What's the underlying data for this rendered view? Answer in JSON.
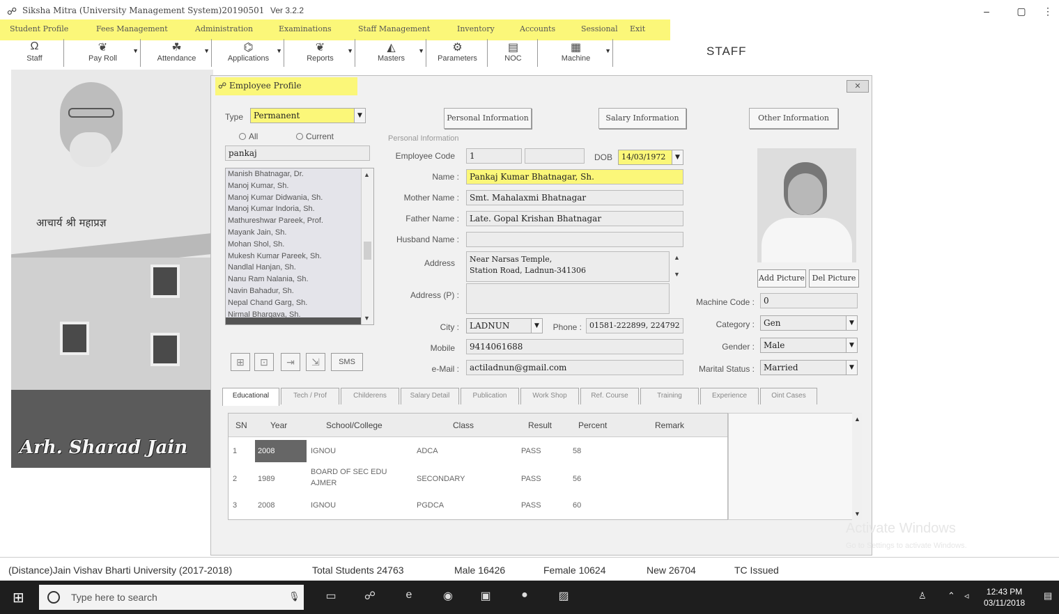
{
  "window": {
    "title": "Siksha Mitra (University Management System)20190501",
    "version": "Ver 3.2.2",
    "minimize": "–",
    "restore": "▢",
    "close": "⋮"
  },
  "menu": [
    "Student Profile",
    "Fees Management",
    "Administration",
    "Examinations",
    "Staff Management",
    "Inventory",
    "Accounts",
    "Sessional",
    "Exit"
  ],
  "toolbar": [
    {
      "label": "Staff",
      "icon": "Ω"
    },
    {
      "label": "Pay Roll",
      "icon": "❦"
    },
    {
      "label": "Attendance",
      "icon": "☘"
    },
    {
      "label": "Applications",
      "icon": "⌬"
    },
    {
      "label": "Reports",
      "icon": "❦"
    },
    {
      "label": "Masters",
      "icon": "◭"
    },
    {
      "label": "Parameters",
      "icon": "⚙"
    },
    {
      "label": "NOC",
      "icon": "▤"
    },
    {
      "label": "Machine",
      "icon": "▦"
    }
  ],
  "module_title": "STAFF",
  "background": {
    "hindi_text": "आचार्य श्री महाप्रज्ञ",
    "signature": "Arh. Sharad Jain"
  },
  "profile": {
    "title": "Employee Profile",
    "close_label": "✕",
    "type_label": "Type",
    "type_value": "Permanent",
    "radio_all": "All",
    "radio_current": "Current",
    "search_value": "pankaj",
    "employees": [
      "Manish Bhatnagar, Dr.",
      "Manoj Kumar, Sh.",
      "Manoj Kumar Didwania, Sh.",
      "Manoj Kumar Indoria, Sh.",
      "Mathureshwar Pareek, Prof.",
      "Mayank Jain, Sh.",
      "Mohan Shol, Sh.",
      "Mukesh Kumar Pareek, Sh.",
      "Nandlal Hanjan, Sh.",
      "Nanu Ram Nalania, Sh.",
      "Navin Bahadur, Sh.",
      "Nepal Chand Garg, Sh.",
      "Nirmal Bhargava, Sh."
    ],
    "sms_label": "SMS",
    "nav_icons": [
      "⊞",
      "⊡",
      "⇥",
      "⇲"
    ],
    "buttons": {
      "personal": "Personal Information",
      "salary": "Salary Information",
      "other": "Other Information"
    },
    "section": "Personal Information",
    "labels": {
      "employee_code": "Employee Code",
      "dob": "DOB",
      "name": "Name :",
      "mother": "Mother Name :",
      "father": "Father Name :",
      "husband": "Husband Name :",
      "address": "Address",
      "address_p": "Address (P) :",
      "city": "City :",
      "phone": "Phone :",
      "mobile": "Mobile",
      "email": "e-Mail :",
      "machine_code": "Machine Code :",
      "category": "Category :",
      "gender": "Gender :",
      "marital": "Marital Status :"
    },
    "values": {
      "employee_code": "1",
      "dob": "14/03/1972",
      "name": "Pankaj Kumar Bhatnagar, Sh.",
      "mother": "Smt. Mahalaxmi Bhatnagar",
      "father": "Late. Gopal Krishan Bhatnagar",
      "husband": "",
      "address_line1": "Near Narsas Temple,",
      "address_line2": "Station Road, Ladnun-341306",
      "address_p": "",
      "city": "LADNUN",
      "phone": "01581-222899, 224792",
      "mobile": "9414061688",
      "email": "actiladnun@gmail.com",
      "machine_code": "0",
      "category": "Gen",
      "gender": "Male",
      "marital": "Married"
    },
    "add_picture": "Add Picture",
    "del_picture": "Del Picture",
    "tabs": [
      "Educational",
      "Tech / Prof",
      "Childerens",
      "Salary Detail",
      "Publication",
      "Work Shop",
      "Ref. Course",
      "Training",
      "Experience",
      "Oint Cases"
    ],
    "grid": {
      "headers": [
        "SN",
        "Year",
        "School/College",
        "Class",
        "Result",
        "Percent",
        "Remark"
      ],
      "rows": [
        {
          "sn": "1",
          "year": "2008",
          "school": "IGNOU",
          "school2": "",
          "class": "ADCA",
          "result": "PASS",
          "percent": "58",
          "remark": ""
        },
        {
          "sn": "2",
          "year": "1989",
          "school": "BOARD OF SEC EDU",
          "school2": "AJMER",
          "class": "SECONDARY",
          "result": "PASS",
          "percent": "56",
          "remark": ""
        },
        {
          "sn": "3",
          "year": "2008",
          "school": "IGNOU",
          "school2": "",
          "class": "PGDCA",
          "result": "PASS",
          "percent": "60",
          "remark": ""
        }
      ]
    }
  },
  "status": {
    "university": "(Distance)Jain Vishav Bharti University (2017-2018)",
    "total_students": "Total Students  24763",
    "male": "Male  16426",
    "female": "Female  10624",
    "new": "New  26704",
    "tc": "TC Issued"
  },
  "watermark": {
    "line1": "Activate Windows",
    "line2": "Go to Settings to activate Windows."
  },
  "taskbar": {
    "search_placeholder": "Type here to search",
    "time": "12:43 PM",
    "date": "03/11/2018"
  }
}
